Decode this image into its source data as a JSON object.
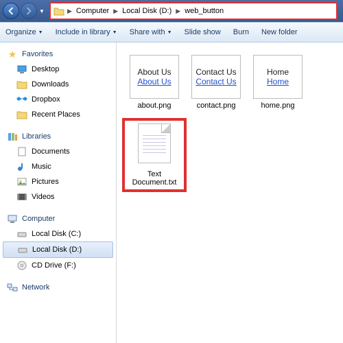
{
  "breadcrumb": {
    "items": [
      "Computer",
      "Local Disk (D:)",
      "web_button"
    ]
  },
  "toolbar": {
    "organize": "Organize",
    "include": "Include in library",
    "share": "Share with",
    "slide": "Slide show",
    "burn": "Burn",
    "newfolder": "New folder"
  },
  "sidebar": {
    "favorites": {
      "label": "Favorites",
      "items": [
        "Desktop",
        "Downloads",
        "Dropbox",
        "Recent Places"
      ]
    },
    "libraries": {
      "label": "Libraries",
      "items": [
        "Documents",
        "Music",
        "Pictures",
        "Videos"
      ]
    },
    "computer": {
      "label": "Computer",
      "items": [
        "Local Disk (C:)",
        "Local Disk (D:)",
        "CD Drive (F:)"
      ],
      "selected": 1
    },
    "network": {
      "label": "Network"
    }
  },
  "files": [
    {
      "name": "about.png",
      "preview": [
        "About Us",
        "About Us"
      ]
    },
    {
      "name": "contact.png",
      "preview": [
        "Contact Us",
        "Contact Us"
      ]
    },
    {
      "name": "home.png",
      "preview": [
        "Home",
        "Home"
      ]
    },
    {
      "name": "Text Document.txt",
      "type": "txt"
    }
  ]
}
